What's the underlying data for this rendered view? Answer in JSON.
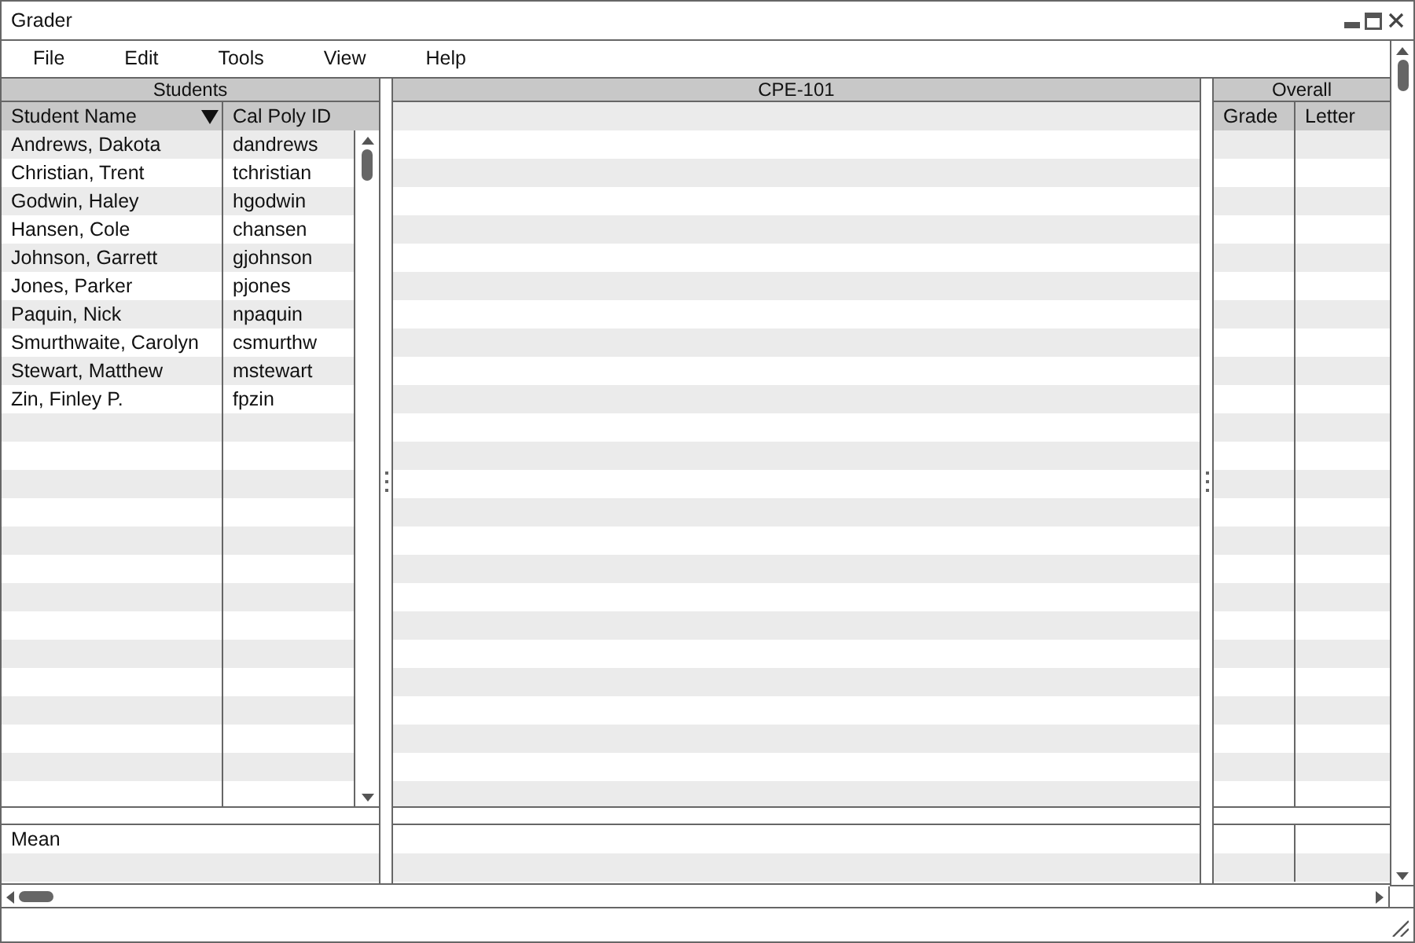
{
  "window": {
    "title": "Grader"
  },
  "menu": [
    "File",
    "Edit",
    "Tools",
    "View",
    "Help"
  ],
  "students_panel": {
    "title": "Students",
    "columns": [
      {
        "label": "Student Name",
        "sorted": true
      },
      {
        "label": "Cal Poly ID",
        "sorted": false
      }
    ],
    "rows": [
      {
        "name": "Andrews, Dakota",
        "id": "dandrews"
      },
      {
        "name": "Christian, Trent",
        "id": "tchristian"
      },
      {
        "name": "Godwin, Haley",
        "id": "hgodwin"
      },
      {
        "name": "Hansen, Cole",
        "id": "chansen"
      },
      {
        "name": "Johnson, Garrett",
        "id": "gjohnson"
      },
      {
        "name": "Jones, Parker",
        "id": "pjones"
      },
      {
        "name": "Paquin, Nick",
        "id": "npaquin"
      },
      {
        "name": "Smurthwaite, Carolyn",
        "id": "csmurthw"
      },
      {
        "name": "Stewart, Matthew",
        "id": "mstewart"
      },
      {
        "name": "Zin, Finley P.",
        "id": "fpzin"
      }
    ],
    "footer_label": "Mean"
  },
  "course_panel": {
    "title": "CPE-101"
  },
  "overall_panel": {
    "title": "Overall",
    "columns": [
      "Grade",
      "Letter"
    ]
  }
}
